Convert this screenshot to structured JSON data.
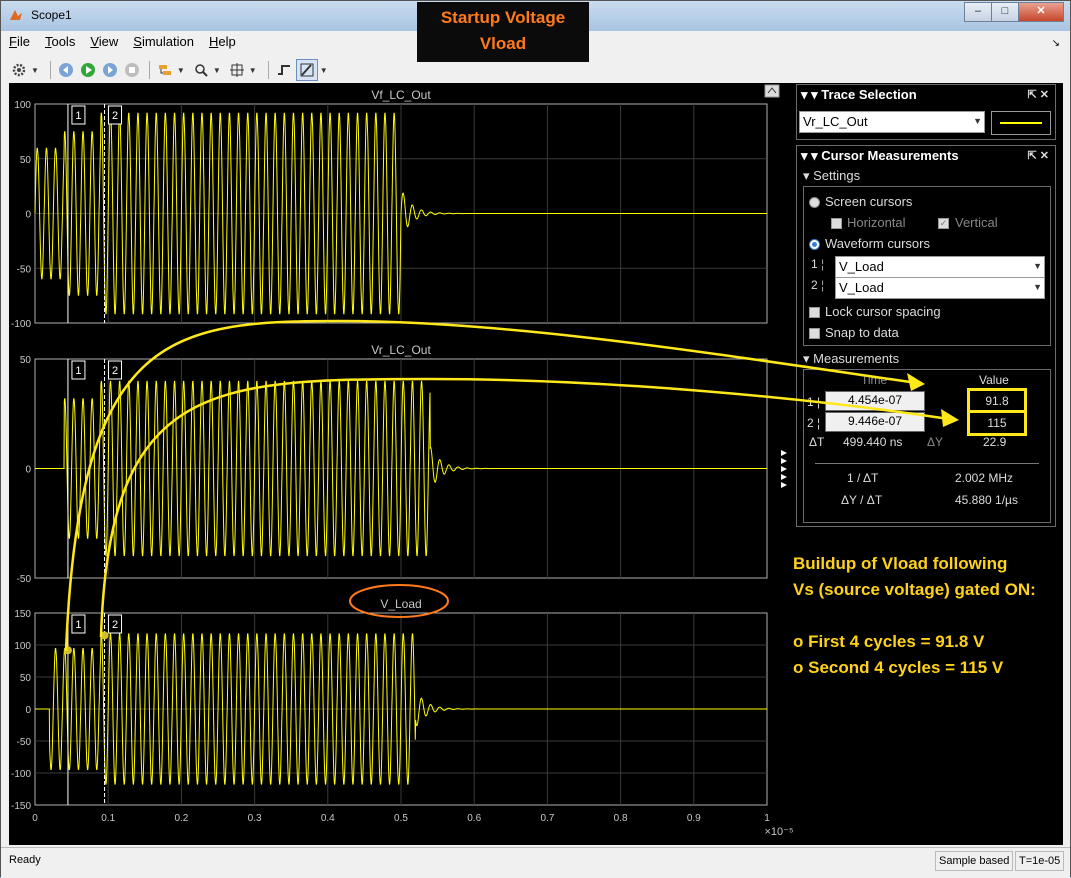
{
  "window": {
    "title": "Scope1"
  },
  "banner": {
    "line1": "Startup Voltage",
    "line2": "Vload"
  },
  "menu": [
    "File",
    "Tools",
    "View",
    "Simulation",
    "Help"
  ],
  "plots": [
    {
      "title": "Vf_LC_Out",
      "yticks": [
        "100",
        "50",
        "0",
        "-50",
        "-100"
      ]
    },
    {
      "title": "Vr_LC_Out",
      "yticks": [
        "50",
        "0",
        "-50"
      ]
    },
    {
      "title": "V_Load",
      "yticks": [
        "150",
        "100",
        "50",
        "0",
        "-50",
        "-100",
        "-150"
      ]
    }
  ],
  "xaxis": {
    "ticks": [
      "0",
      "0.1",
      "0.2",
      "0.3",
      "0.4",
      "0.5",
      "0.6",
      "0.7",
      "0.8",
      "0.9",
      "1"
    ],
    "multiplier": "×10⁻⁵"
  },
  "cursor_labels": [
    "1",
    "2"
  ],
  "trace_selection": {
    "title": "Trace Selection",
    "value": "Vr_LC_Out",
    "line_color": "#ffff00"
  },
  "cursor_measurements": {
    "title": "Cursor Measurements",
    "settings_label": "Settings",
    "screen_cursors": "Screen cursors",
    "horizontal": "Horizontal",
    "vertical": "Vertical",
    "waveform_cursors": "Waveform cursors",
    "cursor1_label": "1",
    "cursor2_label": "2",
    "cursor1_signal": "V_Load",
    "cursor2_signal": "V_Load",
    "lock_spacing": "Lock cursor spacing",
    "snap_to_data": "Snap to data",
    "measurements_label": "Measurements",
    "time_header": "Time",
    "value_header": "Value",
    "t1": "4.454e-07",
    "t2": "9.446e-07",
    "v1": "91.8",
    "v2": "115",
    "dT_label": "ΔT",
    "dT": "499.440 ns",
    "dY_label": "ΔY",
    "dY": "22.9",
    "inv_dT_label": "1 / ΔT",
    "inv_dT": "2.002 MHz",
    "slope_label": "ΔY / ΔT",
    "slope": "45.880 1/µs"
  },
  "notes": {
    "line1": "Buildup of Vload following",
    "line2": "Vs (source voltage) gated ON:",
    "bullet1": "o  First 4 cycles = 91.8 V",
    "bullet2": "o  Second 4 cycles = 115 V"
  },
  "status": {
    "left": "Ready",
    "mode": "Sample based",
    "time": "T=1e-05"
  },
  "colors": {
    "trace": "#ffff00",
    "annotation": "#ffe81a",
    "highlight": "#ff7a1a",
    "axes": "#b0b0b0"
  }
}
